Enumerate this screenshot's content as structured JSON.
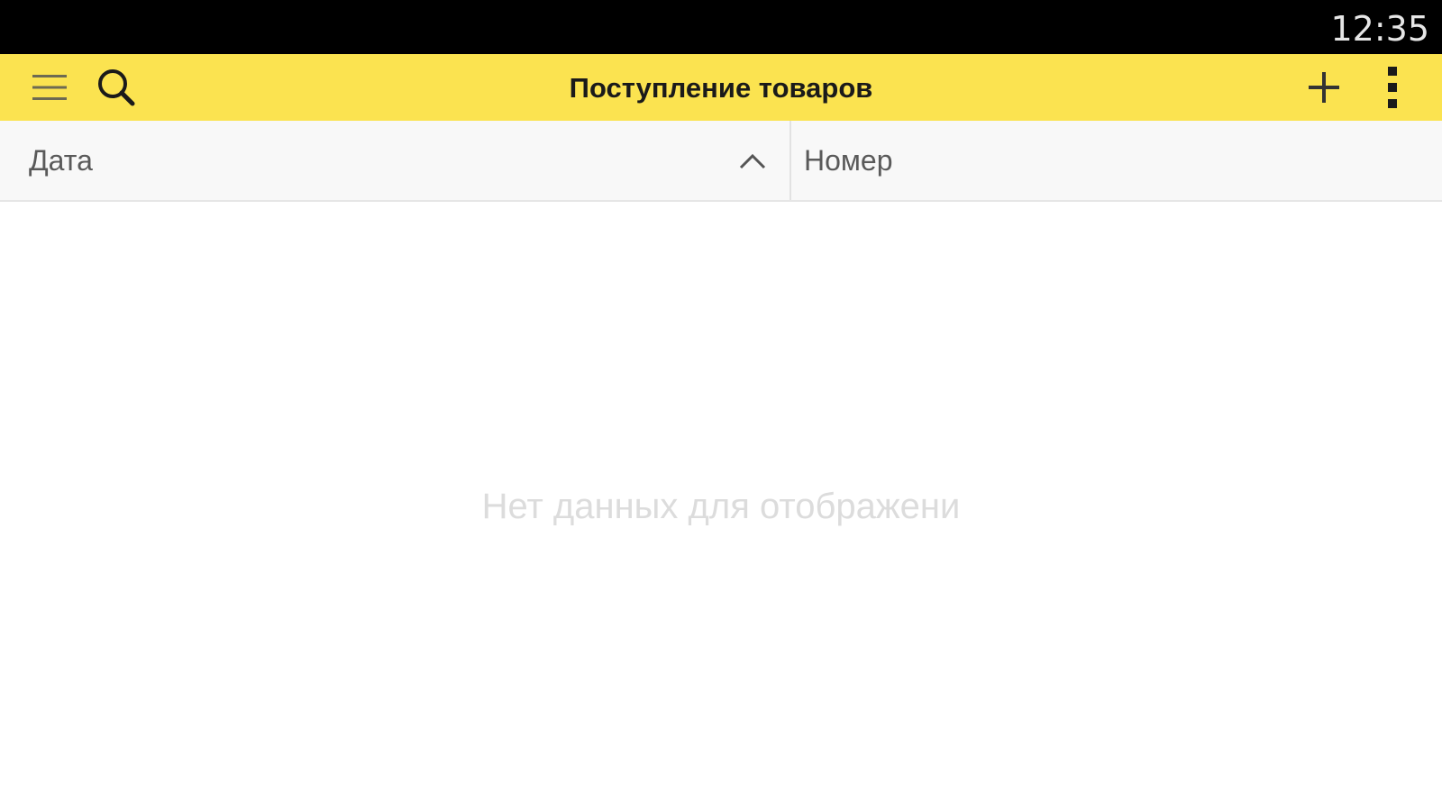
{
  "status_bar": {
    "time": "12:35"
  },
  "toolbar": {
    "title": "Поступление товаров",
    "background_color": "#fbe350",
    "icons": {
      "menu": "hamburger-menu-icon",
      "search": "search-icon",
      "add": "plus-icon",
      "more": "more-vertical-icon"
    }
  },
  "table": {
    "columns": [
      {
        "label": "Дата",
        "sort": "ascending"
      },
      {
        "label": "Номер"
      }
    ],
    "empty_message": "Нет данных для отображени"
  }
}
